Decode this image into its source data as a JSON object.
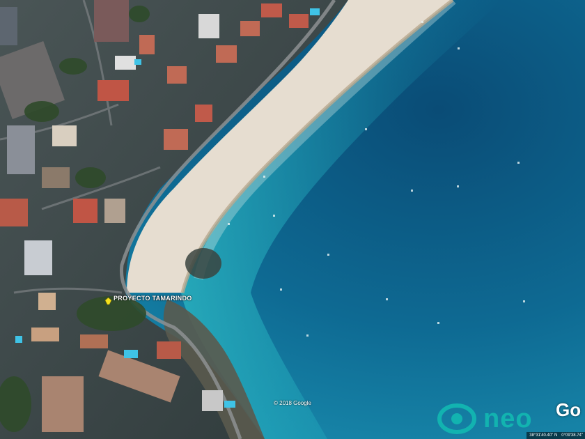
{
  "map": {
    "place_label": "PROYECTO TAMARINDO",
    "copyright": "© 2018 Google",
    "google_logo": "Go",
    "brand_name": "neo",
    "coords": {
      "latitude": "38°31'40.40\" N",
      "longitude": "0°09'38.74\""
    }
  },
  "colors": {
    "sea_deep": "#0b4f78",
    "sea_shallow": "#1aa2b5",
    "beach_sand": "#e6ddd0",
    "land": "#3c4a4c",
    "pin": "#f5e11c",
    "brand": "#12b3b0"
  },
  "icons": [
    "map-pin-icon",
    "brand-logo-icon"
  ]
}
